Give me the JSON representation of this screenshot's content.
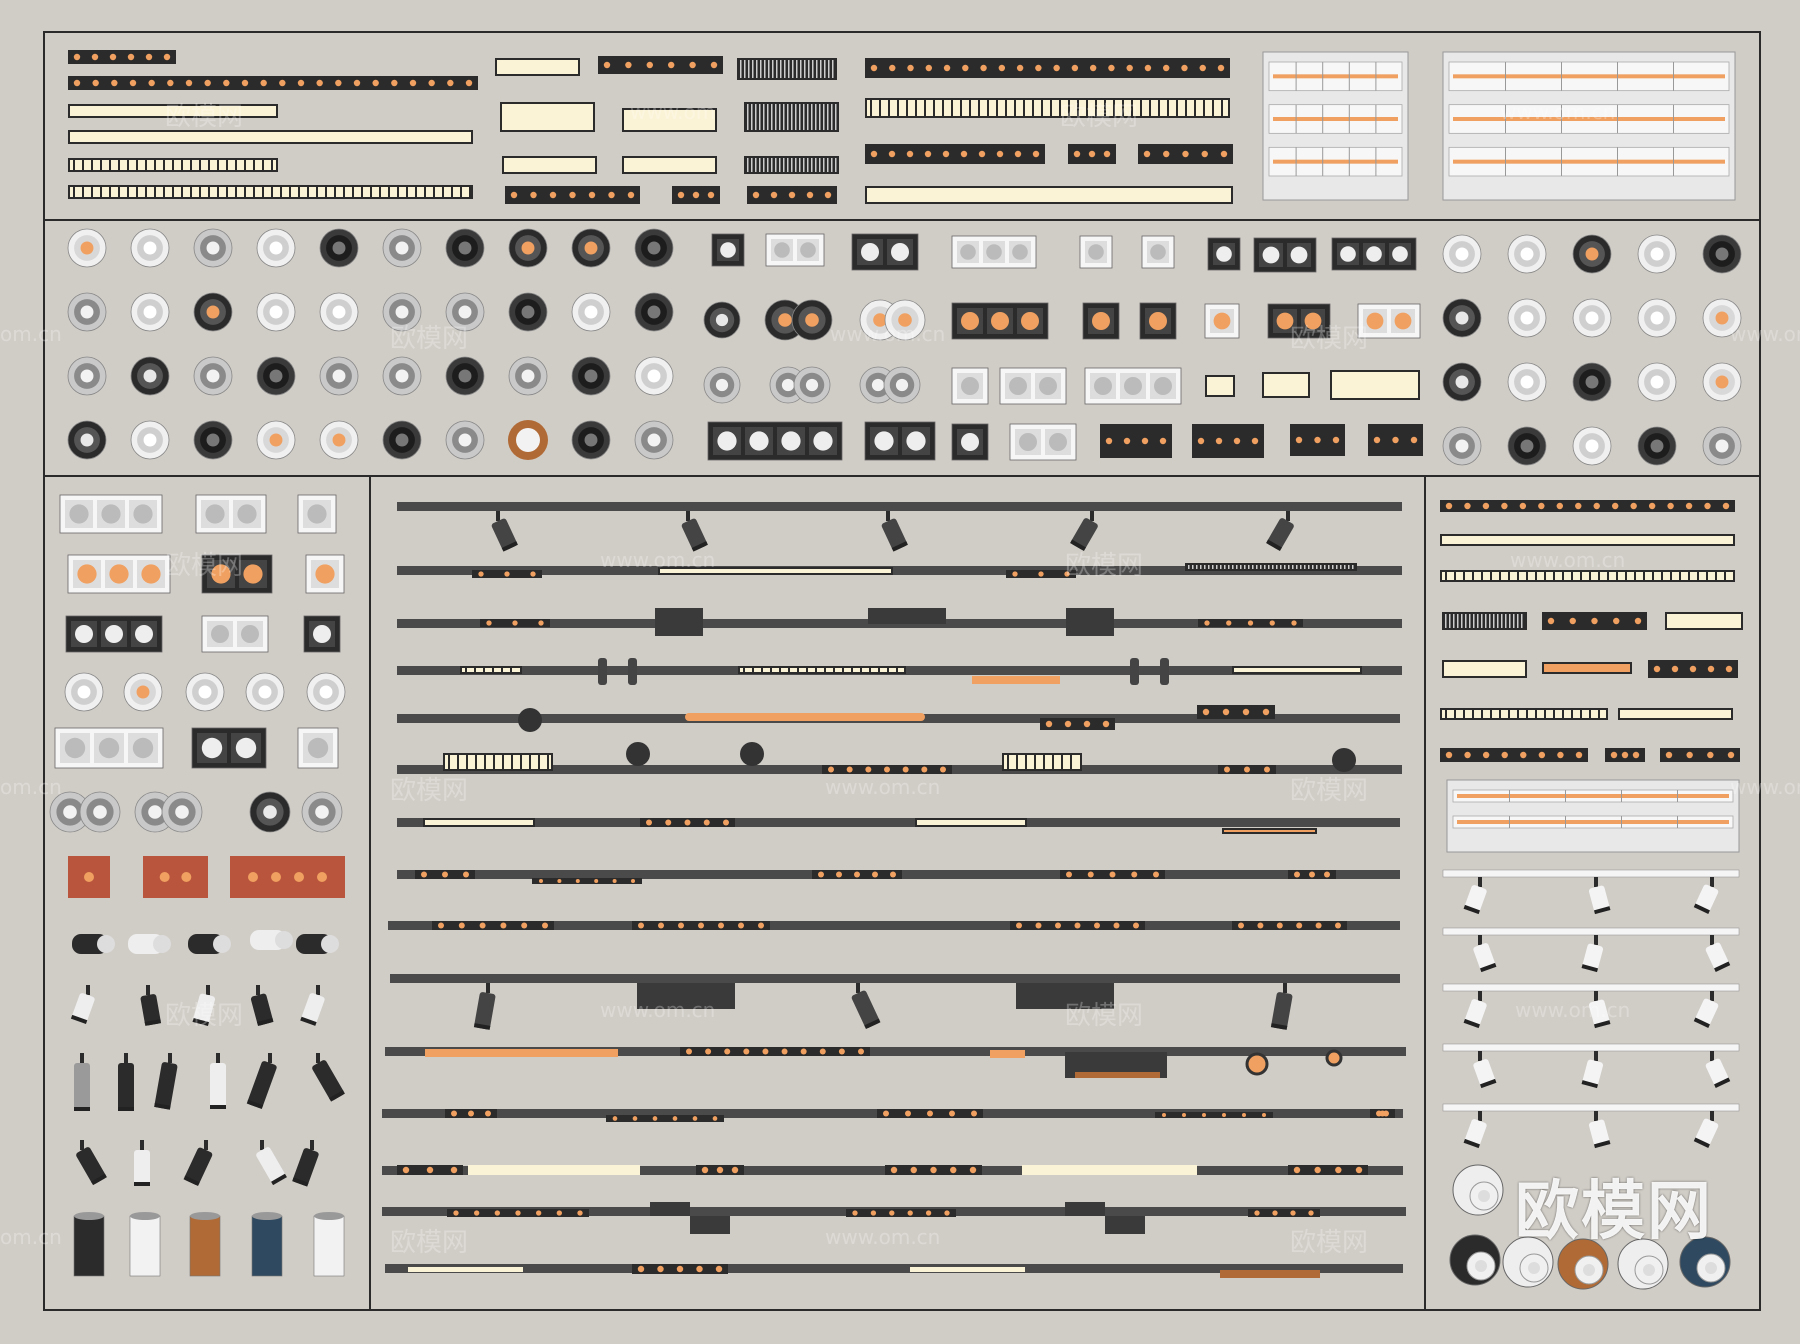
{
  "watermarks": {
    "brand": "欧模网",
    "url": "www.om.cn",
    "url_short": "om.cn",
    "url_partial": "www.om",
    "url_tail": ".cn"
  },
  "colors": {
    "background": "#d0ccc6",
    "frame": "#2a2a2a",
    "black": "#2b2b2b",
    "track": "#4a4a4a",
    "warm": "#f0a060",
    "cream": "#fbf3d6",
    "white": "#f4f4f4",
    "gray": "#9a9a9a",
    "copper": "#b06a35",
    "navy": "#2f4a60",
    "terracotta": "#b8553c"
  }
}
